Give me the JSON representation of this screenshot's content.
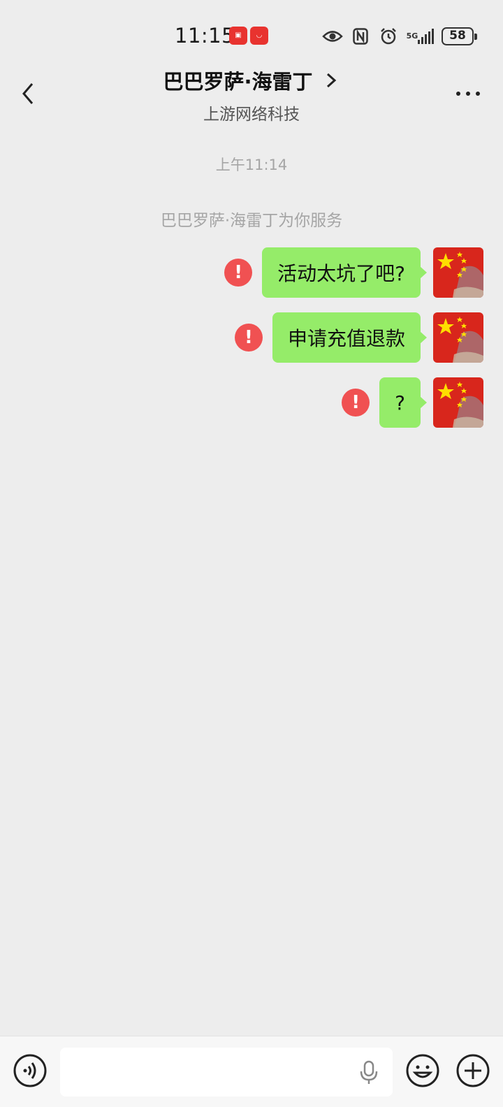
{
  "status_bar": {
    "time": "11:15",
    "battery": "58",
    "network": "5G"
  },
  "header": {
    "title": "巴巴罗萨·海雷丁",
    "subtitle": "上游网络科技"
  },
  "chat": {
    "timestamp": "上午11:14",
    "system_message": "巴巴罗萨·海雷丁为你服务",
    "messages": [
      {
        "text": "活动太坑了吧?",
        "status": "failed"
      },
      {
        "text": "申请充值退款",
        "status": "failed"
      },
      {
        "text": "?",
        "status": "failed"
      }
    ]
  },
  "input": {
    "placeholder": ""
  },
  "colors": {
    "bubble": "#95ec69",
    "error": "#f05152",
    "background": "#ededed"
  },
  "icons": {
    "back": "chevron-left-icon",
    "more": "more-dots-icon",
    "voice": "voice-icon",
    "mic": "microphone-icon",
    "emoji": "emoji-icon",
    "plus": "plus-icon"
  }
}
